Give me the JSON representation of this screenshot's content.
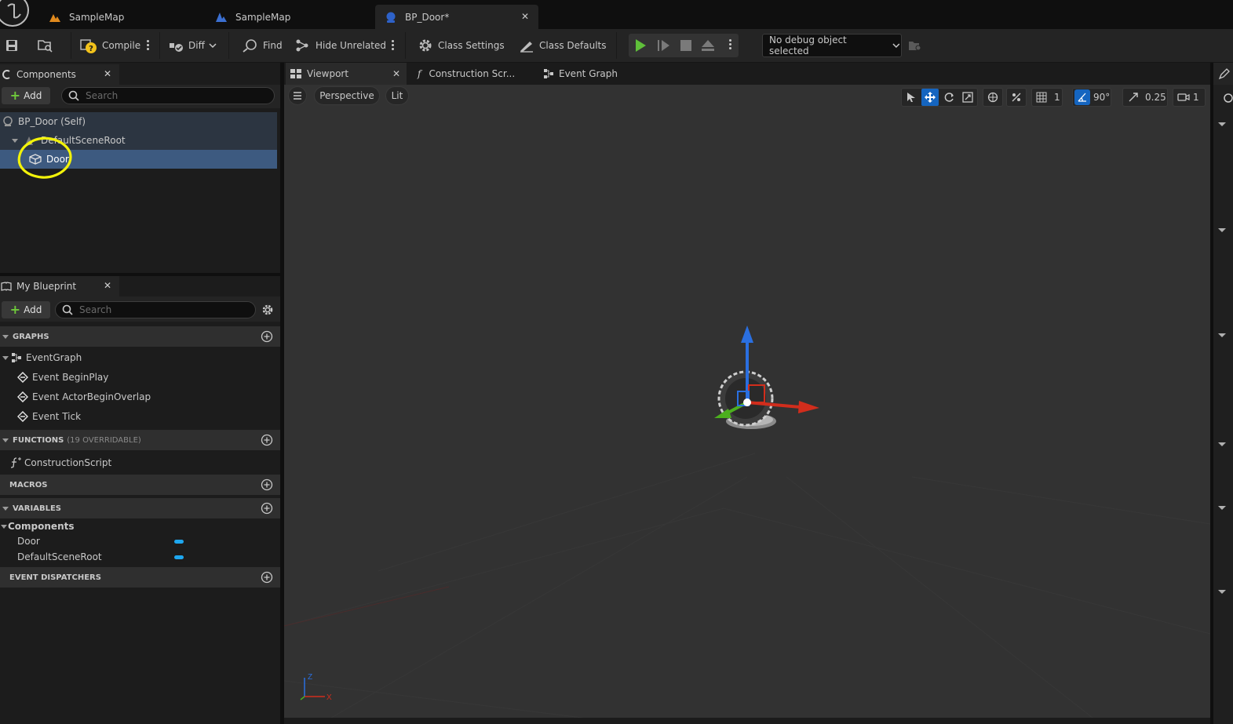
{
  "tabs": [
    {
      "label": "SampleMap",
      "icon": "map-icon"
    },
    {
      "label": "SampleMap",
      "icon": "map-icon"
    },
    {
      "label": "BP_Door*",
      "icon": "blueprint-icon",
      "close": "✕"
    }
  ],
  "toolbar": {
    "compile": "Compile",
    "diff": "Diff",
    "find": "Find",
    "hide_unrelated": "Hide Unrelated",
    "class_settings": "Class Settings",
    "class_defaults": "Class Defaults",
    "debug_object": "No debug object selected"
  },
  "components": {
    "title": "Components",
    "close": "✕",
    "add": "Add",
    "search_placeholder": "Search",
    "items": [
      {
        "label": "BP_Door (Self)"
      },
      {
        "label": "DefaultSceneRoot"
      },
      {
        "label": "Door"
      }
    ]
  },
  "my_blueprint": {
    "title": "My Blueprint",
    "close": "✕",
    "add": "Add",
    "search_placeholder": "Search",
    "graphs_header": "GRAPHS",
    "event_graph": "EventGraph",
    "events": [
      "Event BeginPlay",
      "Event ActorBeginOverlap",
      "Event Tick"
    ],
    "functions_header": "FUNCTIONS",
    "functions_count": "(19 OVERRIDABLE)",
    "construction_script": "ConstructionScript",
    "macros_header": "MACROS",
    "variables_header": "VARIABLES",
    "components_category": "Components",
    "variables": [
      "Door",
      "DefaultSceneRoot"
    ],
    "dispatchers_header": "EVENT DISPATCHERS"
  },
  "editor_tabs": {
    "viewport": "Viewport",
    "viewport_close": "✕",
    "construction_script": "Construction Scr...",
    "event_graph": "Event Graph"
  },
  "viewport": {
    "perspective": "Perspective",
    "lit": "Lit",
    "grid_snap": "1",
    "rotation_snap": "90°",
    "scale_snap": "0.25",
    "camera_speed": "1",
    "axis_z": "Z",
    "axis_x": "X"
  },
  "colors": {
    "accent_blue": "#1565c0",
    "highlight_yellow": "#f2f20a",
    "axis_x": "#d12d1c",
    "axis_y": "#4caf1e",
    "axis_z": "#2a6fe0",
    "variable_pill": "#1ea7ef"
  }
}
